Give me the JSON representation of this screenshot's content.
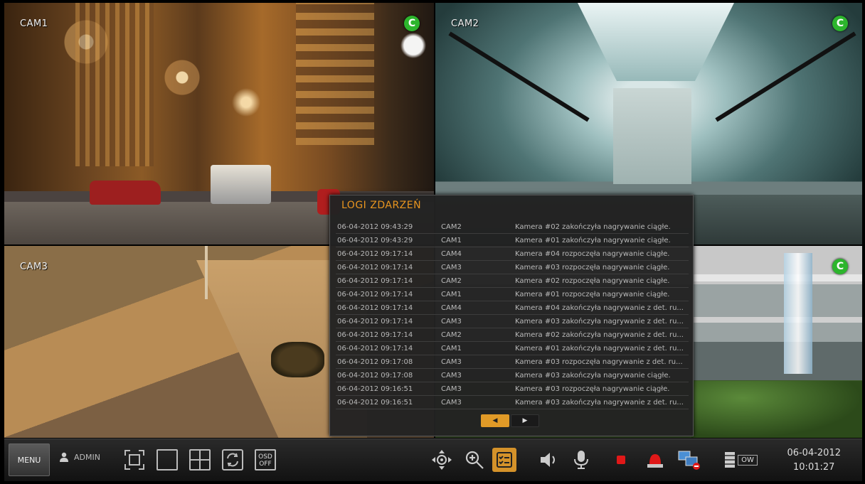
{
  "cameras": [
    {
      "label": "CAM1",
      "status": "C"
    },
    {
      "label": "CAM2",
      "status": "C"
    },
    {
      "label": "CAM3"
    },
    {
      "label": "",
      "status": "C"
    }
  ],
  "event_log": {
    "title": "LOGI ZDARZEŃ",
    "rows": [
      {
        "datetime": "06-04-2012  09:43:29",
        "camera": "CAM2",
        "message": "Kamera #02 zakończyła nagrywanie ciągłe."
      },
      {
        "datetime": "06-04-2012  09:43:29",
        "camera": "CAM1",
        "message": "Kamera #01 zakończyła nagrywanie ciągłe."
      },
      {
        "datetime": "06-04-2012  09:17:14",
        "camera": "CAM4",
        "message": "Kamera #04 rozpoczęła nagrywanie ciągłe."
      },
      {
        "datetime": "06-04-2012  09:17:14",
        "camera": "CAM3",
        "message": "Kamera #03 rozpoczęła nagrywanie ciągłe."
      },
      {
        "datetime": "06-04-2012  09:17:14",
        "camera": "CAM2",
        "message": "Kamera #02 rozpoczęła nagrywanie ciągłe."
      },
      {
        "datetime": "06-04-2012  09:17:14",
        "camera": "CAM1",
        "message": "Kamera #01 rozpoczęła nagrywanie ciągłe."
      },
      {
        "datetime": "06-04-2012  09:17:14",
        "camera": "CAM4",
        "message": "Kamera #04 zakończyła nagrywanie z det. ru..."
      },
      {
        "datetime": "06-04-2012  09:17:14",
        "camera": "CAM3",
        "message": "Kamera #03 zakończyła nagrywanie z det. ru..."
      },
      {
        "datetime": "06-04-2012  09:17:14",
        "camera": "CAM2",
        "message": "Kamera #02 zakończyła nagrywanie z det. ru..."
      },
      {
        "datetime": "06-04-2012  09:17:14",
        "camera": "CAM1",
        "message": "Kamera #01 zakończyła nagrywanie z det. ru..."
      },
      {
        "datetime": "06-04-2012  09:17:08",
        "camera": "CAM3",
        "message": "Kamera #03 rozpoczęła nagrywanie z det. ru..."
      },
      {
        "datetime": "06-04-2012  09:17:08",
        "camera": "CAM3",
        "message": "Kamera #03 zakończyła nagrywanie ciągłe."
      },
      {
        "datetime": "06-04-2012  09:16:51",
        "camera": "CAM3",
        "message": "Kamera #03 rozpoczęła nagrywanie ciągłe."
      },
      {
        "datetime": "06-04-2012  09:16:51",
        "camera": "CAM3",
        "message": "Kamera #03 zakończyła nagrywanie z det. ru..."
      }
    ],
    "pager": {
      "prev": "◀",
      "next": "▶"
    }
  },
  "toolbar": {
    "menu_label": "MENU",
    "user_label": "ADMIN",
    "osd_label_top": "OSD",
    "osd_label_bottom": "OFF",
    "ow_label": "OW",
    "date": "06-04-2012",
    "time": "10:01:27"
  },
  "colors": {
    "accent": "#e09a27",
    "status_green": "#2db52d",
    "record_red": "#e01818"
  }
}
